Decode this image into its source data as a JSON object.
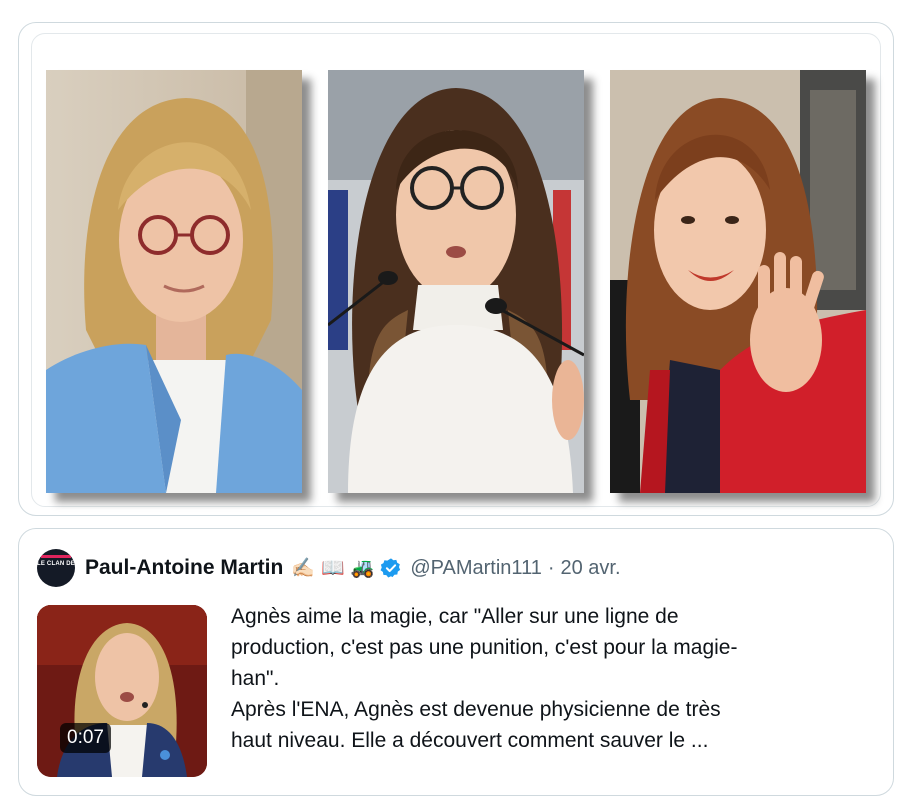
{
  "photos": [
    {
      "alt": "portrait-1"
    },
    {
      "alt": "portrait-2"
    },
    {
      "alt": "portrait-3"
    }
  ],
  "tweet": {
    "avatar_text": "LE CLAN DES SEIGNEURS",
    "author_name": "Paul-Antoine Martin",
    "author_emojis": [
      "✍🏻",
      "📖",
      "🚜"
    ],
    "handle": "@PAMartin111",
    "separator": "·",
    "date": "20 avr.",
    "video_duration": "0:07",
    "text_paragraph_1": "Agnès aime la magie, car \"Aller sur une ligne de\nproduction, c'est pas une punition, c'est pour la magie-\nhan\".",
    "text_paragraph_2": "Après l'ENA, Agnès est devenue physicienne de très\nhaut niveau. Elle a découvert comment sauver le ..."
  },
  "colors": {
    "verified": "#1d9bf0",
    "text_primary": "#0f1419",
    "text_secondary": "#536471",
    "border": "#cfd9de"
  }
}
